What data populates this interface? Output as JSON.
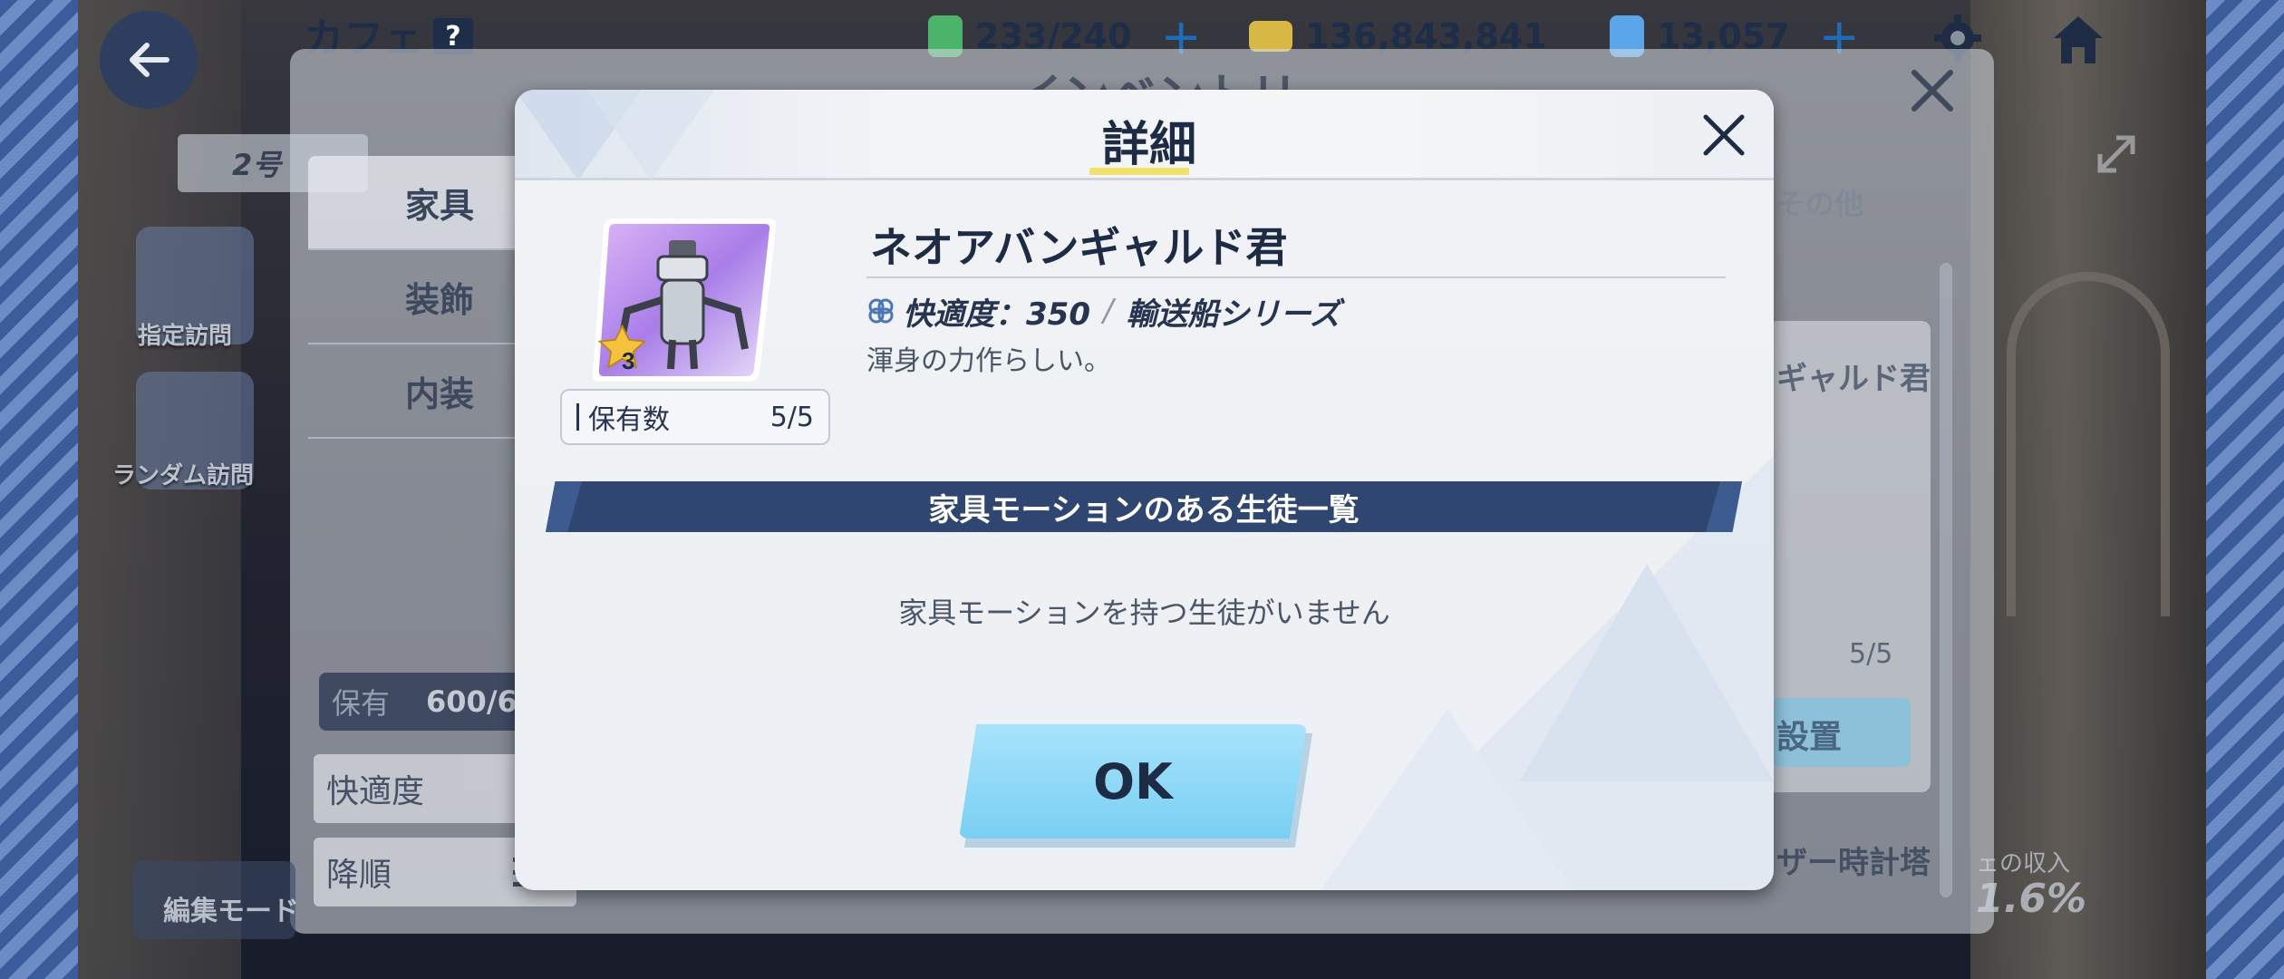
{
  "topbar": {
    "title": "カフェ",
    "help": "?",
    "ap": "233/240",
    "credits": "136,843,841",
    "gems": "13,057",
    "plus": "+"
  },
  "inventory": {
    "title": "インベントリ",
    "floor_label": "2号",
    "categories": [
      "家具",
      "装飾",
      "内装"
    ],
    "owned_label": "保有",
    "owned_value": "600/6",
    "sort_label": "快適度",
    "order_label": "降順",
    "edit_mode": "編集モード",
    "right_tab": "その他",
    "right_card_name": "ギャルド君",
    "right_card_count": "5/5",
    "right_place": "設置",
    "right_card2_name": "ザー時計塔",
    "income_label": "ェの収入",
    "income_value": "1.6%"
  },
  "side": {
    "designated_visit": "指定訪問",
    "random_visit": "ランダム訪問"
  },
  "modal": {
    "title": "詳細",
    "item_name": "ネオアバンギャルド君",
    "rarity": "3",
    "owned_label": "保有数",
    "owned_value": "5/5",
    "comfort_label": "快適度：350",
    "series": "輸送船シリーズ",
    "description": "渾身の力作らしい。",
    "section_title": "家具モーションのある生徒一覧",
    "empty_message": "家具モーションを持つ生徒がいません",
    "ok_label": "OK"
  },
  "colors": {
    "navy": "#1d2b45",
    "banner": "#2f4670",
    "ok_button": "#79cff3",
    "title_underline": "#f3e26a"
  }
}
